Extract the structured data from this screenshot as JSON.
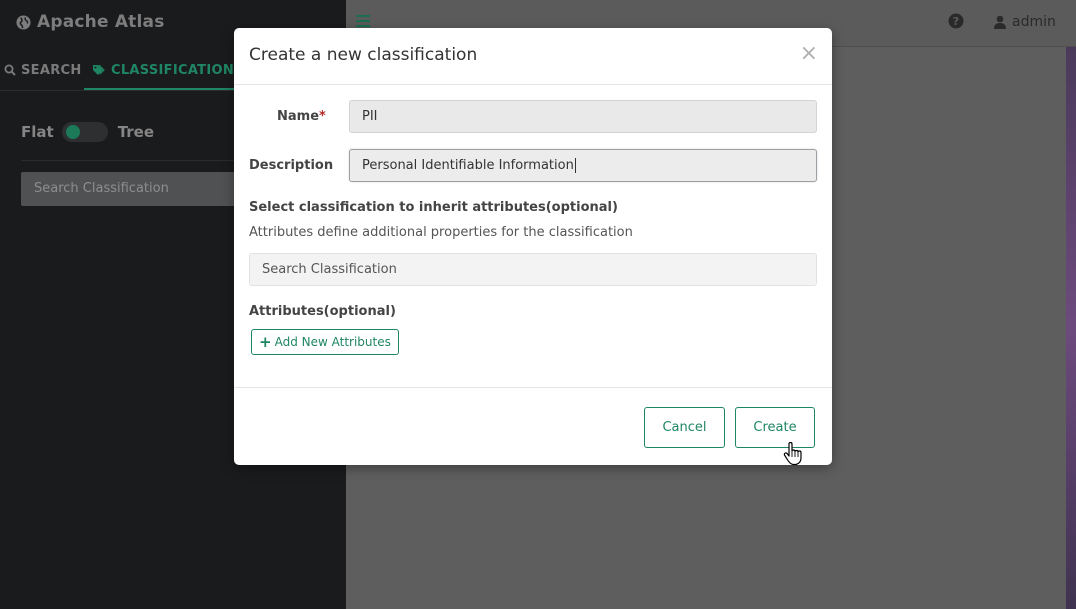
{
  "app": {
    "title": "Apache Atlas",
    "accent_color": "#1f8663"
  },
  "sidebar": {
    "tabs": [
      {
        "label": "SEARCH",
        "icon": "search-icon",
        "active": false
      },
      {
        "label": "CLASSIFICATION",
        "icon": "tag-icon",
        "active": true
      }
    ],
    "toggle": {
      "left_label": "Flat",
      "right_label": "Tree",
      "state": "flat"
    },
    "search_placeholder": "Search Classification"
  },
  "topbar": {
    "user": "admin"
  },
  "modal": {
    "title": "Create a new classification",
    "close_glyph": "×",
    "name_label": "Name",
    "name_required_mark": "*",
    "name_value": "PII",
    "description_label": "Description",
    "description_value": "Personal Identifiable Information",
    "inherit_title": "Select classification to inherit attributes(optional)",
    "inherit_help": "Attributes define additional properties for the classification",
    "inherit_search_placeholder": "Search Classification",
    "attributes_title": "Attributes(optional)",
    "add_attributes_label": "Add New Attributes",
    "cancel_label": "Cancel",
    "create_label": "Create"
  }
}
